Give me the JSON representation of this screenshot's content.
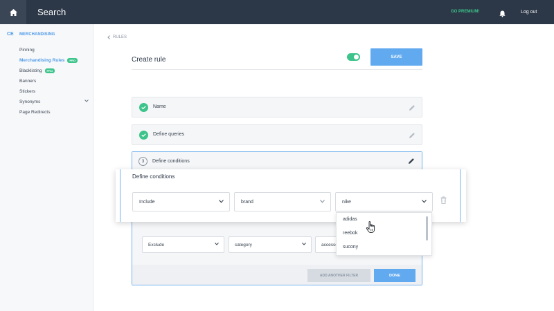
{
  "header": {
    "title": "Search",
    "premium_label": "GO PREMIUM!",
    "logout_label": "Log out"
  },
  "sidebar": {
    "section_icon": "CE",
    "section_title": "MERCHANDISING",
    "items": [
      {
        "label": "Pinning"
      },
      {
        "label": "Merchandising Rules",
        "badge": "PRO"
      },
      {
        "label": "Blacklisting",
        "badge": "PRO"
      },
      {
        "label": "Banners"
      },
      {
        "label": "Stickers"
      },
      {
        "label": "Synonyms"
      },
      {
        "label": "Page Redirects"
      }
    ]
  },
  "page": {
    "breadcrumb": "RULES",
    "title": "Create rule",
    "save_label": "SAVE",
    "active_toggle": true
  },
  "steps": [
    {
      "label": "Name",
      "state": "done"
    },
    {
      "label": "Define queries",
      "state": "done"
    },
    {
      "number": "3",
      "label": "Define conditions",
      "state": "active"
    }
  ],
  "conditions": {
    "title": "Define conditions",
    "row": {
      "mode": "Include",
      "attribute": "brand",
      "value": "nike"
    },
    "dropdown_options": [
      "adidas",
      "reebok",
      "sucony"
    ],
    "second_row": {
      "mode": "Exclude",
      "attribute": "category",
      "value": "accesso"
    },
    "add_filter_label": "ADD ANOTHER FILTER",
    "done_label": "DONE"
  },
  "colors": {
    "topbar": "#2c3747",
    "accent": "#4f9be8",
    "success": "#3cc48a",
    "button": "#62aaf0"
  }
}
